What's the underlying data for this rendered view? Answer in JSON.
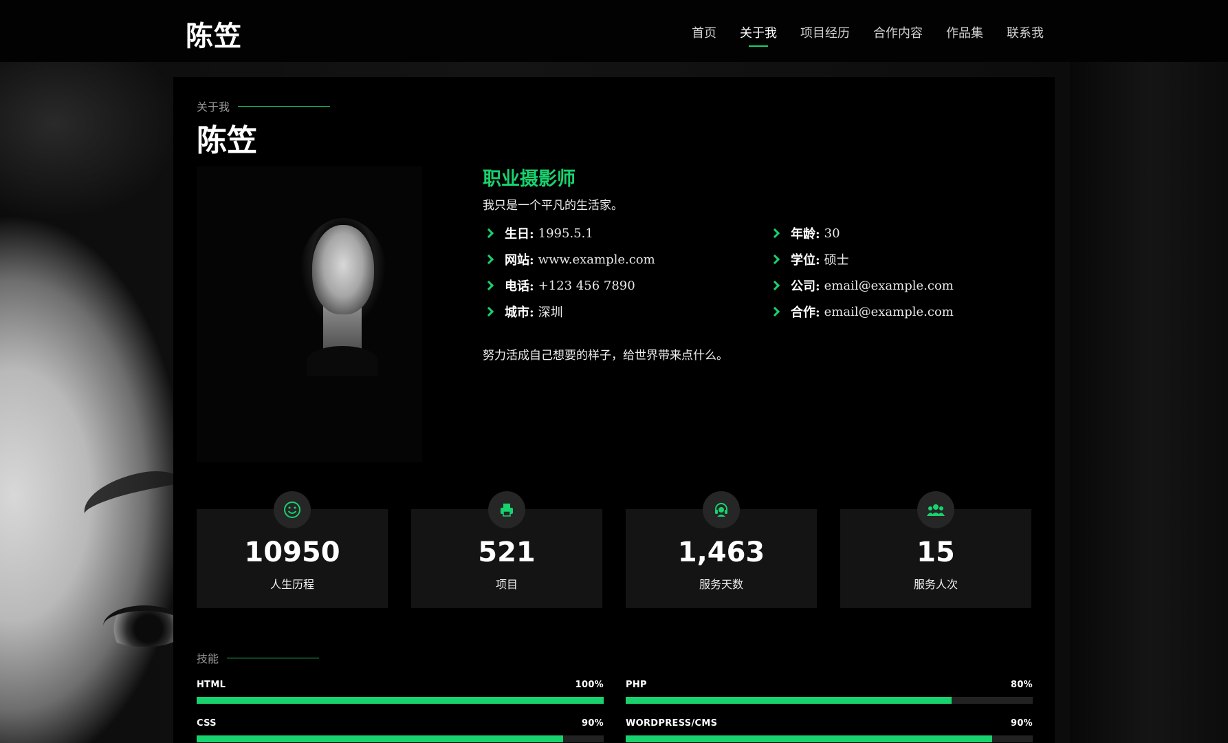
{
  "header": {
    "logo": "陈笠",
    "nav": [
      "首页",
      "关于我",
      "项目经历",
      "合作内容",
      "作品集",
      "联系我"
    ],
    "active_index": 1
  },
  "about": {
    "tag": "关于我",
    "title": "陈笠",
    "role": "职业摄影师",
    "intro": "我只是一个平凡的生活家。",
    "info_left": [
      {
        "label": "生日:",
        "value": "1995.5.1"
      },
      {
        "label": "网站:",
        "value": "www.example.com"
      },
      {
        "label": "电话:",
        "value": "+123 456 7890"
      },
      {
        "label": "城市:",
        "value": "深圳"
      }
    ],
    "info_right": [
      {
        "label": "年龄:",
        "value": "30"
      },
      {
        "label": "学位:",
        "value": "硕士"
      },
      {
        "label": "公司:",
        "value": "email@example.com"
      },
      {
        "label": "合作:",
        "value": "email@example.com"
      }
    ],
    "outro": "努力活成自己想要的样子，给世界带来点什么。"
  },
  "counters": [
    {
      "icon": "smile-icon",
      "number": "10950",
      "label": "人生历程"
    },
    {
      "icon": "printer-icon",
      "number": "521",
      "label": "项目"
    },
    {
      "icon": "headset-icon",
      "number": "1,463",
      "label": "服务天数"
    },
    {
      "icon": "users-icon",
      "number": "15",
      "label": "服务人次"
    }
  ],
  "skills": {
    "tag": "技能",
    "items": [
      {
        "name": "HTML",
        "percent_label": "100%",
        "level": 100
      },
      {
        "name": "PHP",
        "percent_label": "80%",
        "level": 80
      },
      {
        "name": "CSS",
        "percent_label": "90%",
        "level": 90
      },
      {
        "name": "WORDPRESS/CMS",
        "percent_label": "90%",
        "level": 90
      }
    ]
  },
  "colors": {
    "accent": "#18d26e",
    "background": "#000000",
    "card": "#141414"
  }
}
